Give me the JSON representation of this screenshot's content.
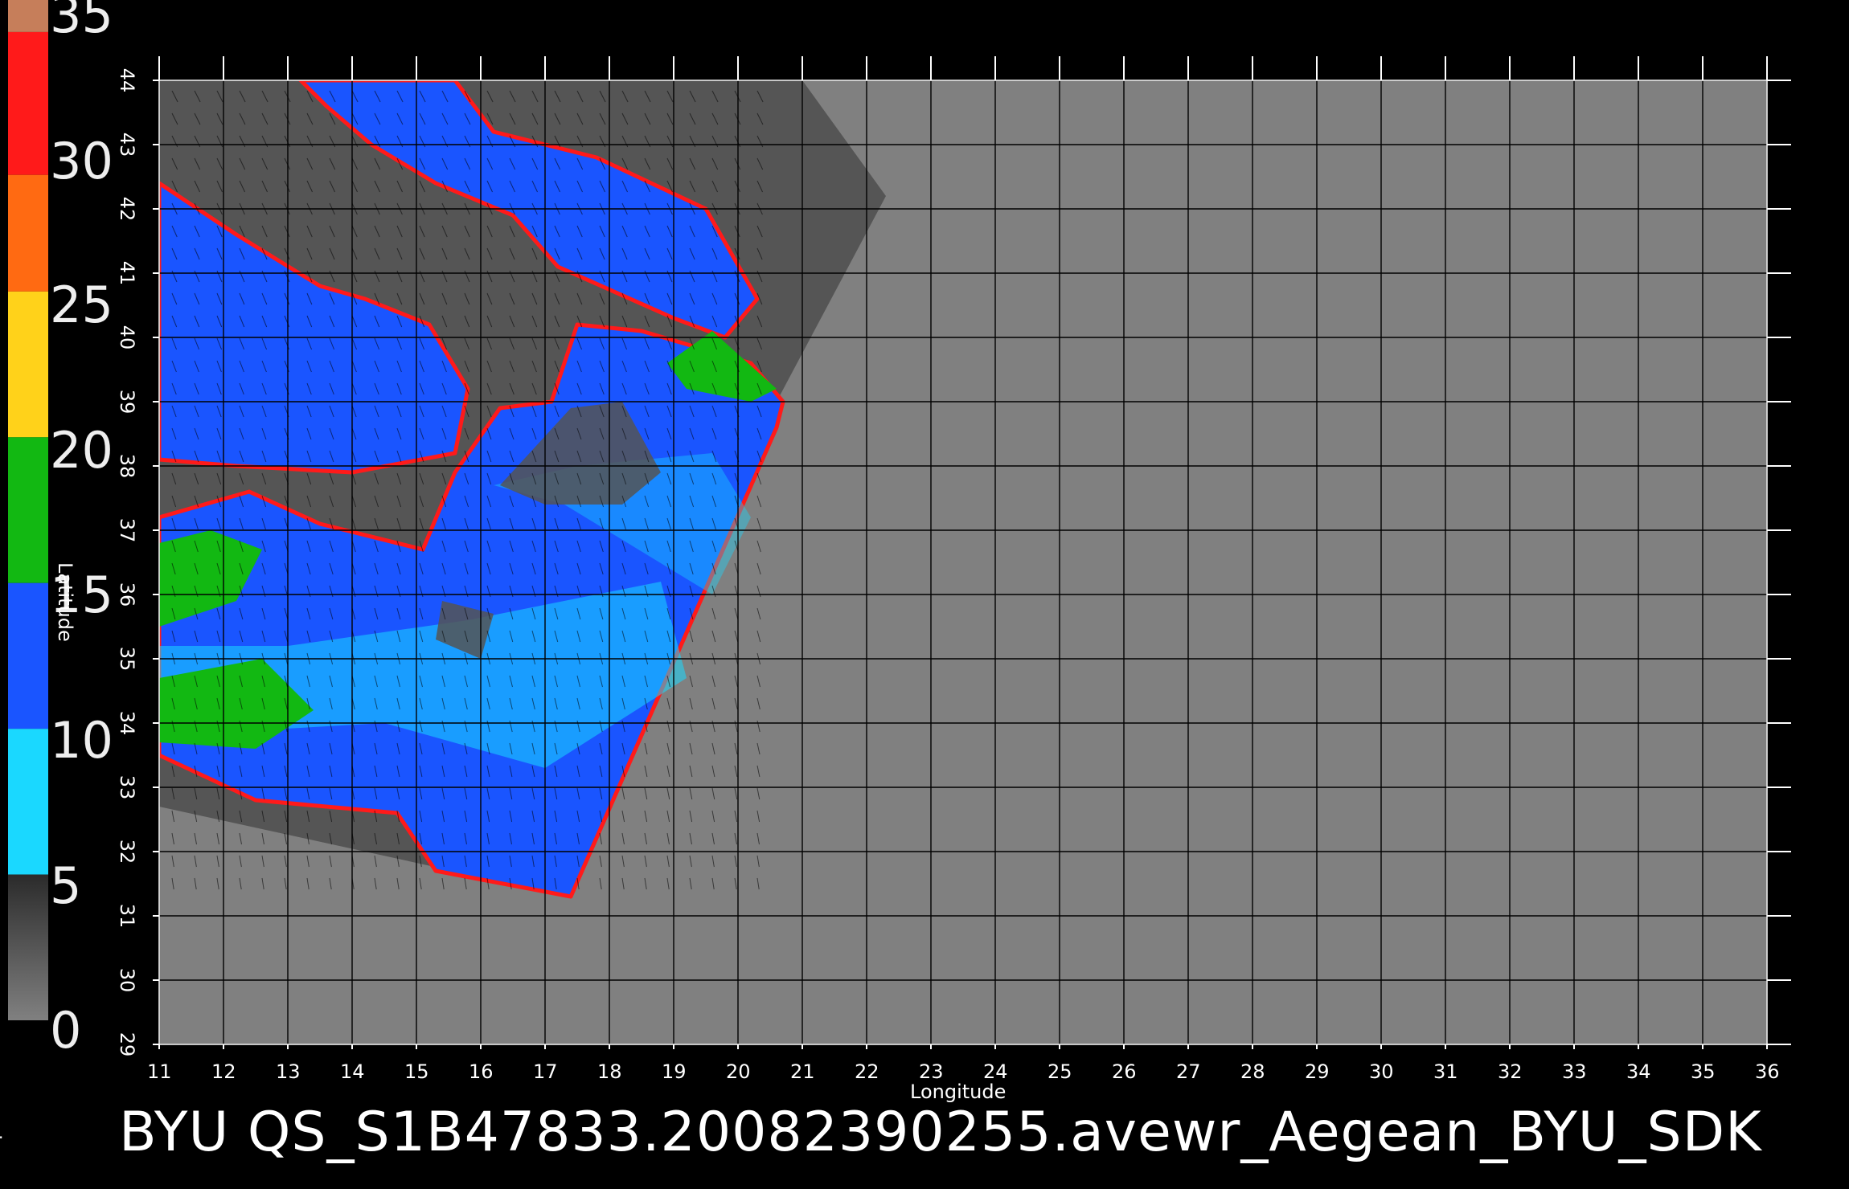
{
  "colorbar": {
    "labels": [
      "35",
      "30",
      "25",
      "20",
      "15",
      "10",
      "5",
      "0"
    ],
    "stops": [
      {
        "from": 35.0,
        "to": 33.9,
        "color": "#c67e5a"
      },
      {
        "from": 33.9,
        "to": 29.0,
        "color": "#ff1a1a"
      },
      {
        "from": 29.0,
        "to": 25.0,
        "color": "#ff6a12"
      },
      {
        "from": 25.0,
        "to": 20.0,
        "color": "#ffd21a"
      },
      {
        "from": 20.0,
        "to": 15.0,
        "color": "#12b812"
      },
      {
        "from": 15.0,
        "to": 10.0,
        "color": "#1a55ff"
      },
      {
        "from": 10.0,
        "to": 5.0,
        "color": "#1ad8ff"
      },
      {
        "from": 5.0,
        "to": 0.0,
        "color": "#4a4a4a"
      }
    ]
  },
  "map": {
    "lon_range": [
      11,
      36
    ],
    "lat_range": [
      29,
      44
    ],
    "x_ticks": [
      "11",
      "12",
      "13",
      "14",
      "15",
      "16",
      "17",
      "18",
      "19",
      "20",
      "21",
      "22",
      "23",
      "24",
      "25",
      "26",
      "27",
      "28",
      "29",
      "30",
      "31",
      "32",
      "33",
      "34",
      "35",
      "36"
    ],
    "y_ticks": [
      "29",
      "30",
      "31",
      "32",
      "33",
      "34",
      "35",
      "36",
      "37",
      "38",
      "39",
      "40",
      "41",
      "42",
      "43",
      "44"
    ],
    "xlabel": "Longitude",
    "ylabel": "Latitude",
    "swath": [
      [
        22.3,
        42.2
      ],
      [
        20.6,
        39.0
      ],
      [
        17.4,
        31.3
      ],
      [
        11.0,
        32.7
      ],
      [
        11.0,
        44.0
      ],
      [
        21.0,
        44.0
      ]
    ],
    "colors": {
      "background": "#808080",
      "land": "#555555",
      "sea_low": "#1ad8ff",
      "sea_mid": "#1a55ff",
      "sea_high": "#12b812",
      "coast": "#ff1a1a",
      "grid": "#000000"
    }
  },
  "footer": {
    "text": "BYU  QS_S1B47833.20082390255.avewr_Aegean_BYU_SDK",
    "dot": "."
  }
}
